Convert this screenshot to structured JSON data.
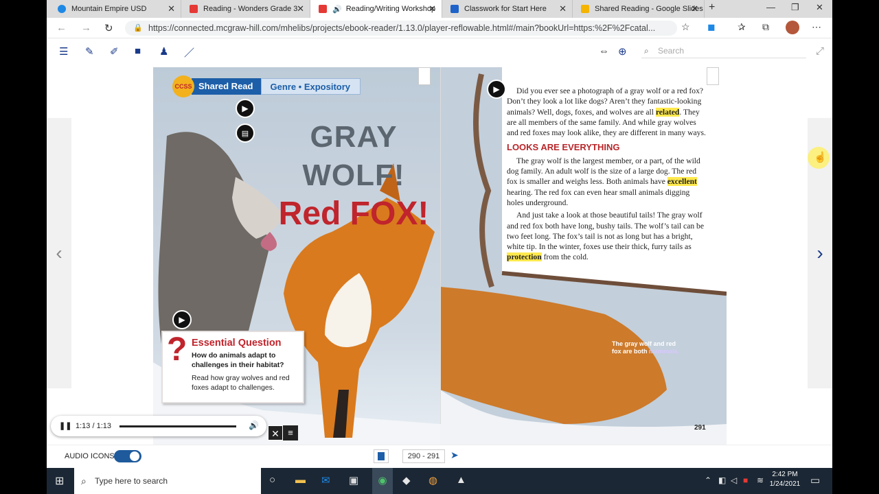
{
  "tabs": [
    {
      "title": "Mountain Empire USD",
      "favicon": "#1e88e5"
    },
    {
      "title": "Reading - Wonders Grade 3",
      "favicon": "#e53935"
    },
    {
      "title": "Reading/Writing Workshop",
      "favicon": "#e53935",
      "active": true
    },
    {
      "title": "Classwork for Start Here",
      "favicon": "#1e63c9"
    },
    {
      "title": "Shared Reading - Google Slides",
      "favicon": "#f4b400"
    }
  ],
  "window_controls": {
    "minimize": "—",
    "restore": "❐",
    "close": "✕"
  },
  "address": {
    "url": "https://connected.mcgraw-hill.com/mhelibs/projects/ebook-reader/1.13.0/player-reflowable.html#/main?bookUrl=https:%2F%2Fcatal..."
  },
  "search": {
    "placeholder": "Search"
  },
  "banner": {
    "ccss": "CCSS",
    "shared": "Shared Read",
    "genre": "Genre • Expository"
  },
  "title": {
    "line1": "GRAY WOLF!",
    "line2": "Red FOX!"
  },
  "eq": {
    "heading": "Essential Question",
    "question": "How do animals adapt to challenges in their habitat?",
    "prompt": "Read how gray wolves and red foxes adapt to challenges."
  },
  "text": {
    "p1a": "Did you ever see a photograph of a gray wolf or a red fox? Don’t they look a lot like dogs? Aren’t they fantastic-looking animals? Well, dogs, foxes, and wolves are all ",
    "p1h": "related",
    "p1b": ". They are all members of the same family. And while gray wolves and red foxes may look alike, they are different in many ways.",
    "heading": "LOOKS ARE EVERYTHING",
    "p2": "The gray wolf is the largest member, or a part, of the wild dog family. An adult wolf is the size of a large dog. The red fox is smaller and weighs less. Both animals have ",
    "p2h": "excellent",
    "p2b": " hearing. The red fox can even hear small animals digging holes underground.",
    "p3": "And just take a look at those beautiful tails! The gray wolf and red fox both have long, bushy tails. The wolf’s tail can be two feet long. The fox’s tail is not as long but has a bright, white tip. In the winter, foxes use their thick, furry tails as ",
    "p3h": "protection",
    "p3b": " from the cold."
  },
  "caption": {
    "text": "The gray wolf and red fox are both ",
    "hl": "mammals."
  },
  "page_number": "291",
  "player": {
    "time": "1:13 / 1:13",
    "progress": 1.0
  },
  "bottom": {
    "audio_label": "AUDIO ICONS:",
    "page_range": "290 - 291"
  },
  "taskbar": {
    "search": "Type here to search",
    "time": "2:42 PM",
    "date": "1/24/2021"
  },
  "colors": {
    "banner_blue": "#1c5ea8",
    "title_red": "#c0242c",
    "title_gray": "#5b6670",
    "toggle": "#1e5a9c"
  }
}
